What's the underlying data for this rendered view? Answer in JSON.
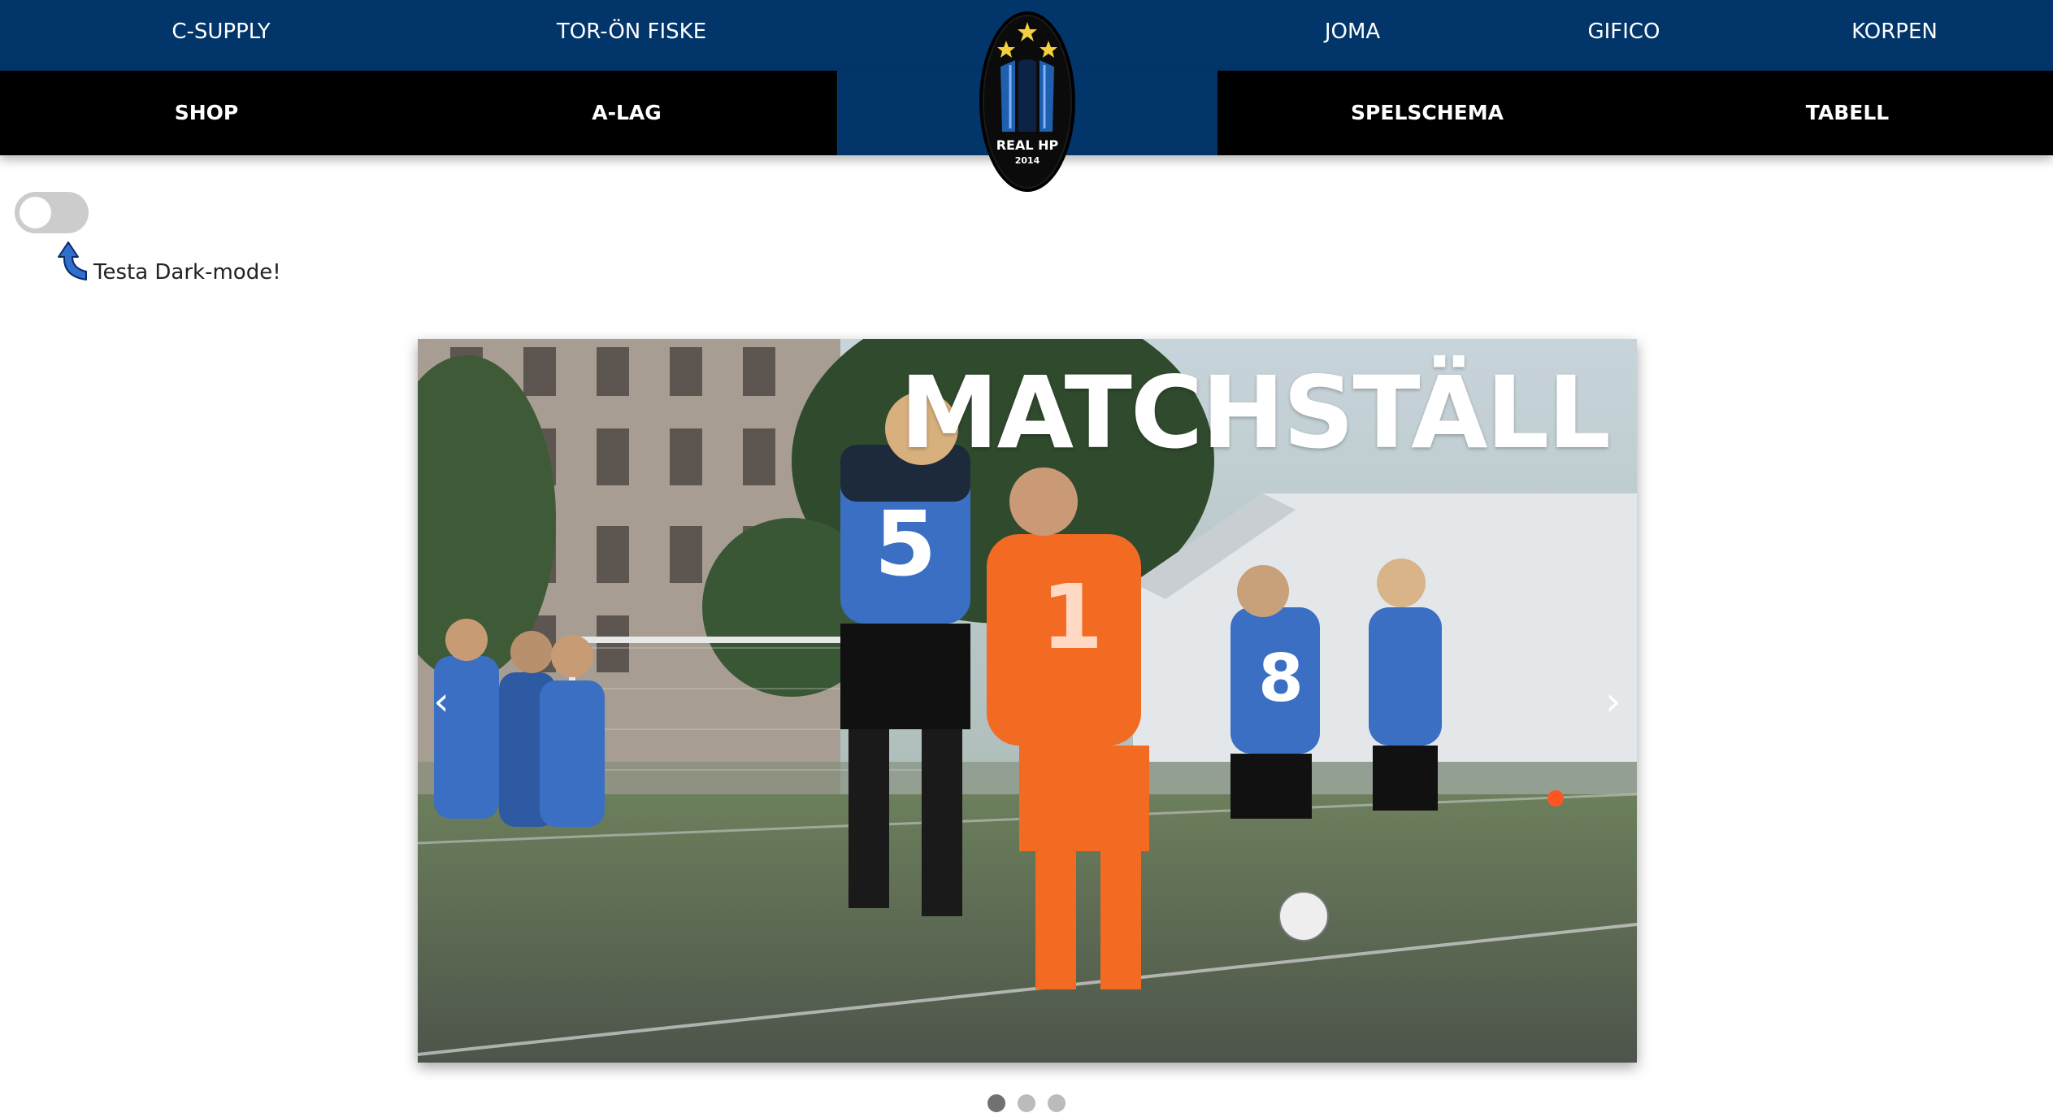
{
  "sponsors": {
    "items": [
      {
        "label": "C-SUPPLY"
      },
      {
        "label": "TOR-ÖN FISKE"
      },
      {
        "label": "JOMA"
      },
      {
        "label": "GIFICO"
      },
      {
        "label": "KORPEN"
      }
    ]
  },
  "nav": {
    "items": [
      {
        "label": "SHOP"
      },
      {
        "label": "A-LAG"
      },
      {
        "label": "SPELSCHEMA"
      },
      {
        "label": "TABELL"
      }
    ]
  },
  "logo": {
    "name": "REAL HP",
    "year": "2014"
  },
  "dark_mode": {
    "enabled": false,
    "hint": "Testa Dark-mode!"
  },
  "carousel": {
    "slide_title": "MATCHSTÄLL",
    "prev_label": "‹",
    "next_label": "›",
    "slide_count": 3,
    "active_index": 0,
    "player_numbers": [
      "5",
      "1",
      "8"
    ]
  },
  "colors": {
    "brand_blue": "#02356a",
    "nav_black": "#000000",
    "kit_blue": "#3a6fc4",
    "keeper_orange": "#f36a22",
    "pitch_green": "#5f6d56"
  }
}
